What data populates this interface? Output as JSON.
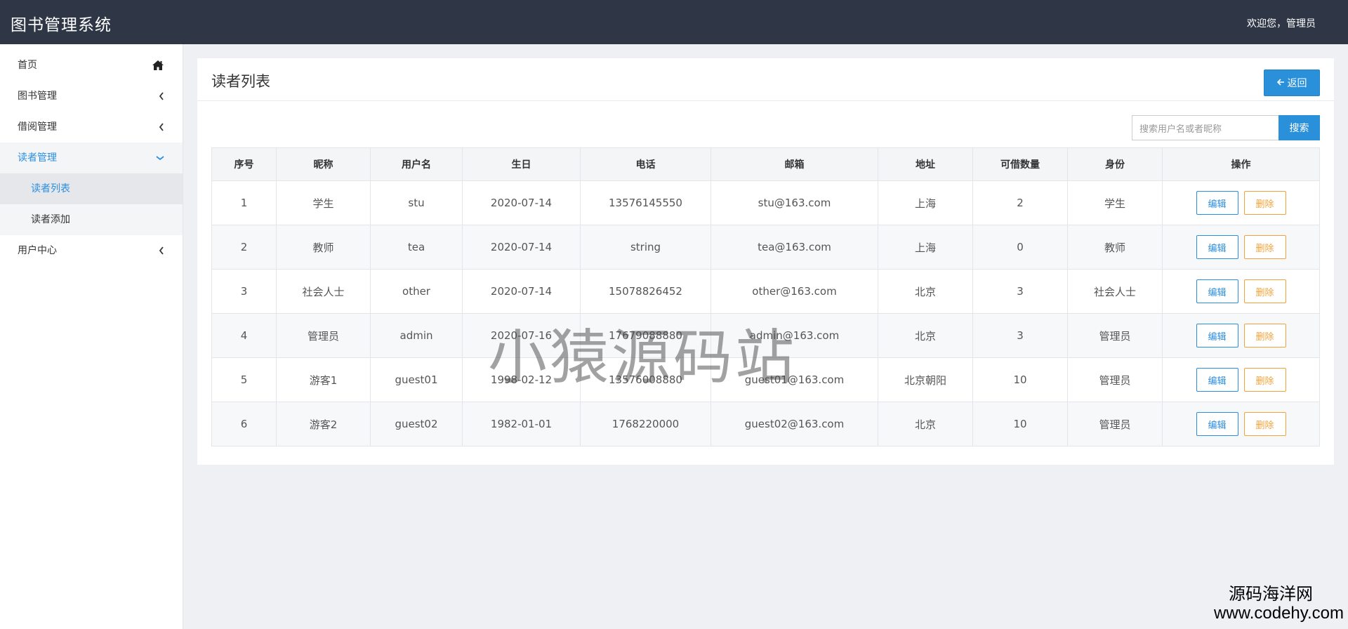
{
  "header": {
    "app_title": "图书管理系统",
    "welcome": "欢迎您，管理员"
  },
  "sidebar": {
    "items": [
      {
        "label": "首页",
        "icon": "home-icon"
      },
      {
        "label": "图书管理",
        "icon": "chevron-left-icon"
      },
      {
        "label": "借阅管理",
        "icon": "chevron-left-icon"
      },
      {
        "label": "读者管理",
        "icon": "chevron-down-icon",
        "expanded": true,
        "children": [
          "读者列表",
          "读者添加"
        ]
      },
      {
        "label": "用户中心",
        "icon": "chevron-left-icon"
      }
    ],
    "active_item": "读者管理",
    "active_child": "读者列表"
  },
  "main": {
    "title": "读者列表",
    "back_label": "返回",
    "search": {
      "placeholder": "搜索用户名或者昵称",
      "button_label": "搜索"
    },
    "table": {
      "columns": [
        "序号",
        "昵称",
        "用户名",
        "生日",
        "电话",
        "邮箱",
        "地址",
        "可借数量",
        "身份",
        "操作"
      ],
      "rows": [
        [
          "1",
          "学生",
          "stu",
          "2020-07-14",
          "13576145550",
          "stu@163.com",
          "上海",
          "2",
          "学生"
        ],
        [
          "2",
          "教师",
          "tea",
          "2020-07-14",
          "string",
          "tea@163.com",
          "上海",
          "0",
          "教师"
        ],
        [
          "3",
          "社会人士",
          "other",
          "2020-07-14",
          "15078826452",
          "other@163.com",
          "北京",
          "3",
          "社会人士"
        ],
        [
          "4",
          "管理员",
          "admin",
          "2020-07-16",
          "17679088880",
          "admin@163.com",
          "北京",
          "3",
          "管理员"
        ],
        [
          "5",
          "游客1",
          "guest01",
          "1998-02-12",
          "13576008880",
          "guest01@163.com",
          "北京朝阳",
          "10",
          "管理员"
        ],
        [
          "6",
          "游客2",
          "guest02",
          "1982-01-01",
          "1768220000",
          "guest02@163.com",
          "北京",
          "10",
          "管理员"
        ]
      ],
      "edit_label": "编辑",
      "delete_label": "删除"
    }
  },
  "watermark": {
    "text": "小猿源码站"
  },
  "corner_mark": {
    "name": "源码海洋网",
    "url": "www.codehy.com"
  },
  "colors": {
    "header_bg": "#2f3747",
    "accent": "#2a90d9",
    "edit": "#2a8ee0",
    "delete": "#f0a33a"
  }
}
